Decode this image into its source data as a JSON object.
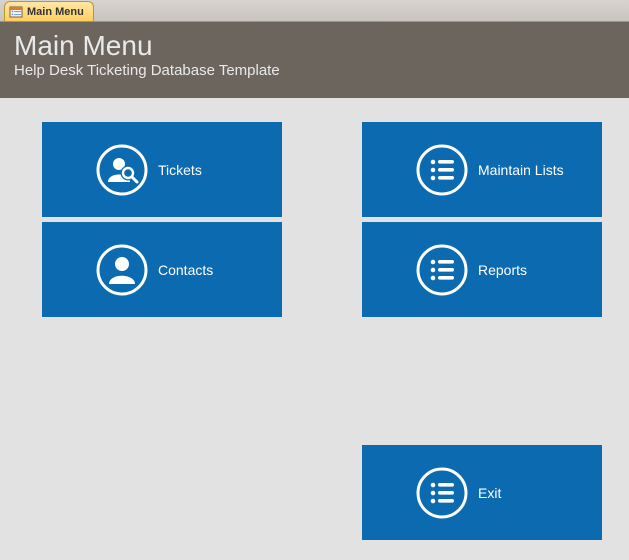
{
  "tab": {
    "label": "Main Menu"
  },
  "header": {
    "title": "Main Menu",
    "subtitle": "Help Desk Ticketing Database Template"
  },
  "tiles": {
    "tickets": "Tickets",
    "contacts": "Contacts",
    "maintainLists": "Maintain Lists",
    "reports": "Reports",
    "exit": "Exit"
  }
}
